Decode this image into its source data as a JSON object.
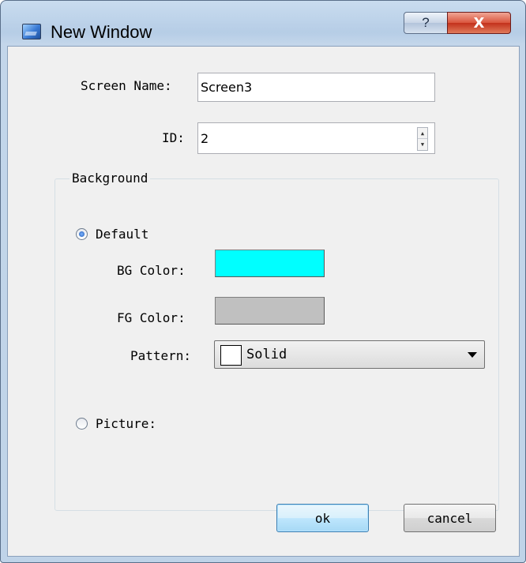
{
  "window": {
    "title": "New Window",
    "help_label": "?",
    "close_label": "X"
  },
  "form": {
    "screen_name_label": "Screen Name:",
    "screen_name_value": "Screen3",
    "id_label": "ID:",
    "id_value": "2"
  },
  "background": {
    "group_title": "Background",
    "default_label": "Default",
    "default_selected": true,
    "bg_color_label": "BG Color:",
    "bg_color": "#00ffff",
    "fg_color_label": "FG Color:",
    "fg_color": "#c0c0c0",
    "pattern_label": "Pattern:",
    "pattern_value": "Solid",
    "picture_label": "Picture:",
    "picture_selected": false
  },
  "buttons": {
    "ok_label": "ok",
    "cancel_label": "cancel"
  },
  "icons": {
    "app": "window-icon",
    "help": "question-mark-icon",
    "close": "close-icon",
    "spin_up": "spin-up-icon",
    "spin_down": "spin-down-icon",
    "dropdown": "chevron-down-icon"
  }
}
